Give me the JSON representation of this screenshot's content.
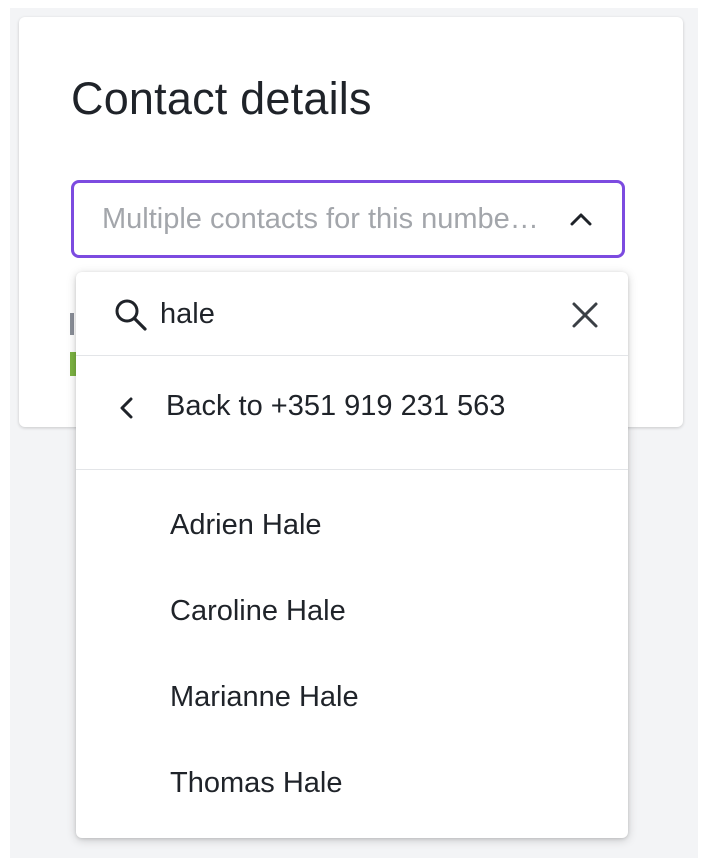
{
  "card": {
    "title": "Contact details"
  },
  "contact_select": {
    "placeholder": "Multiple contacts for this numbe…",
    "expanded": true,
    "icon": "chevron-up-icon"
  },
  "dropdown": {
    "search": {
      "value": "hale",
      "icon": "search-icon",
      "clear_icon": "close-icon"
    },
    "back": {
      "label": "Back to +351 919 231 563",
      "icon": "chevron-left-icon"
    },
    "results": [
      {
        "name": "Adrien Hale"
      },
      {
        "name": "Caroline Hale"
      },
      {
        "name": "Marianne Hale"
      },
      {
        "name": "Thomas Hale"
      }
    ]
  },
  "colors": {
    "accent": "#7c4be0",
    "text": "#1f2329",
    "placeholder": "#a3a6ab",
    "divider": "#e3e5e8",
    "background": "#f3f4f6",
    "status_green": "#7cb342"
  }
}
